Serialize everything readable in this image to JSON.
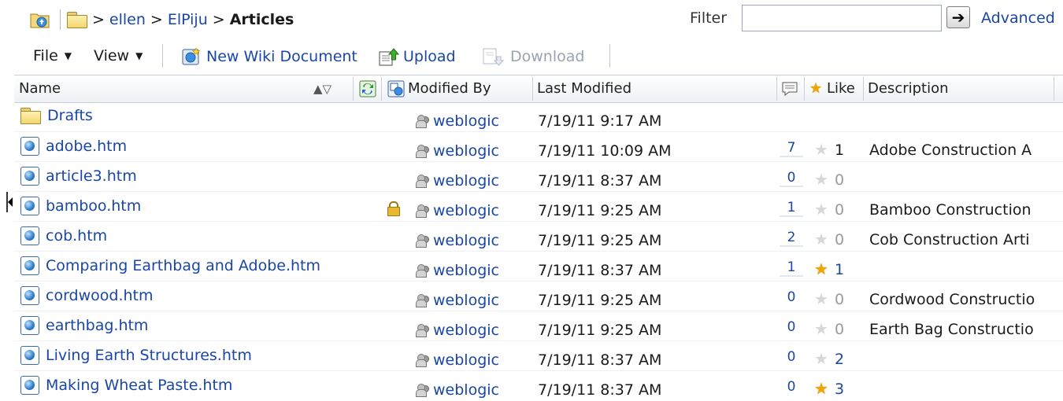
{
  "breadcrumb": {
    "items": [
      ">",
      "ellen",
      ">",
      "ElPiju",
      ">"
    ],
    "current": "Articles"
  },
  "filter": {
    "label": "Filter",
    "value": "",
    "advanced_label": "Advanced",
    "go_icon": "arrow-right-icon"
  },
  "toolbar": {
    "file_label": "File",
    "view_label": "View",
    "new_wiki_label": "New Wiki Document",
    "upload_label": "Upload",
    "download_label": "Download"
  },
  "columns": {
    "name": "Name",
    "modified_by": "Modified By",
    "last_modified": "Last Modified",
    "like": "Like",
    "description": "Description"
  },
  "rows": [
    {
      "name": "Drafts",
      "type": "folder",
      "modified_by": "weblogic",
      "last_modified": "7/19/11 9:17 AM",
      "comments": "",
      "likes": "",
      "liked": false,
      "description": "",
      "locked": false
    },
    {
      "name": "adobe.htm",
      "type": "page",
      "modified_by": "weblogic",
      "last_modified": "7/19/11 10:09 AM",
      "comments": "7",
      "likes": "1",
      "liked": false,
      "description": "Adobe Construction A",
      "locked": false
    },
    {
      "name": "article3.htm",
      "type": "page",
      "modified_by": "weblogic",
      "last_modified": "7/19/11 8:37 AM",
      "comments": "0",
      "likes": "0",
      "liked": false,
      "description": "",
      "locked": false
    },
    {
      "name": "bamboo.htm",
      "type": "page",
      "modified_by": "weblogic",
      "last_modified": "7/19/11 9:25 AM",
      "comments": "1",
      "likes": "0",
      "liked": false,
      "description": "Bamboo Construction",
      "locked": true
    },
    {
      "name": "cob.htm",
      "type": "page",
      "modified_by": "weblogic",
      "last_modified": "7/19/11 9:25 AM",
      "comments": "2",
      "likes": "0",
      "liked": false,
      "description": "Cob Construction Arti",
      "locked": false
    },
    {
      "name": "Comparing Earthbag and Adobe.htm",
      "type": "page",
      "modified_by": "weblogic",
      "last_modified": "7/19/11 8:37 AM",
      "comments": "1",
      "likes": "1",
      "liked": true,
      "description": "",
      "locked": false
    },
    {
      "name": "cordwood.htm",
      "type": "page",
      "modified_by": "weblogic",
      "last_modified": "7/19/11 9:25 AM",
      "comments": "0",
      "likes": "0",
      "liked": false,
      "description": "Cordwood Constructio",
      "locked": false
    },
    {
      "name": "earthbag.htm",
      "type": "page",
      "modified_by": "weblogic",
      "last_modified": "7/19/11 9:25 AM",
      "comments": "0",
      "likes": "0",
      "liked": false,
      "description": "Earth Bag Constructio",
      "locked": false
    },
    {
      "name": "Living Earth Structures.htm",
      "type": "page",
      "modified_by": "weblogic",
      "last_modified": "7/19/11 8:37 AM",
      "comments": "0",
      "likes": "2",
      "liked": false,
      "description": "",
      "locked": false
    },
    {
      "name": "Making Wheat Paste.htm",
      "type": "page",
      "modified_by": "weblogic",
      "last_modified": "7/19/11 8:37 AM",
      "comments": "0",
      "likes": "3",
      "liked": true,
      "description": "",
      "locked": false
    }
  ],
  "colors": {
    "link": "#1a46a6",
    "star_on": "#f0a500",
    "star_off": "#d7d7d7"
  }
}
